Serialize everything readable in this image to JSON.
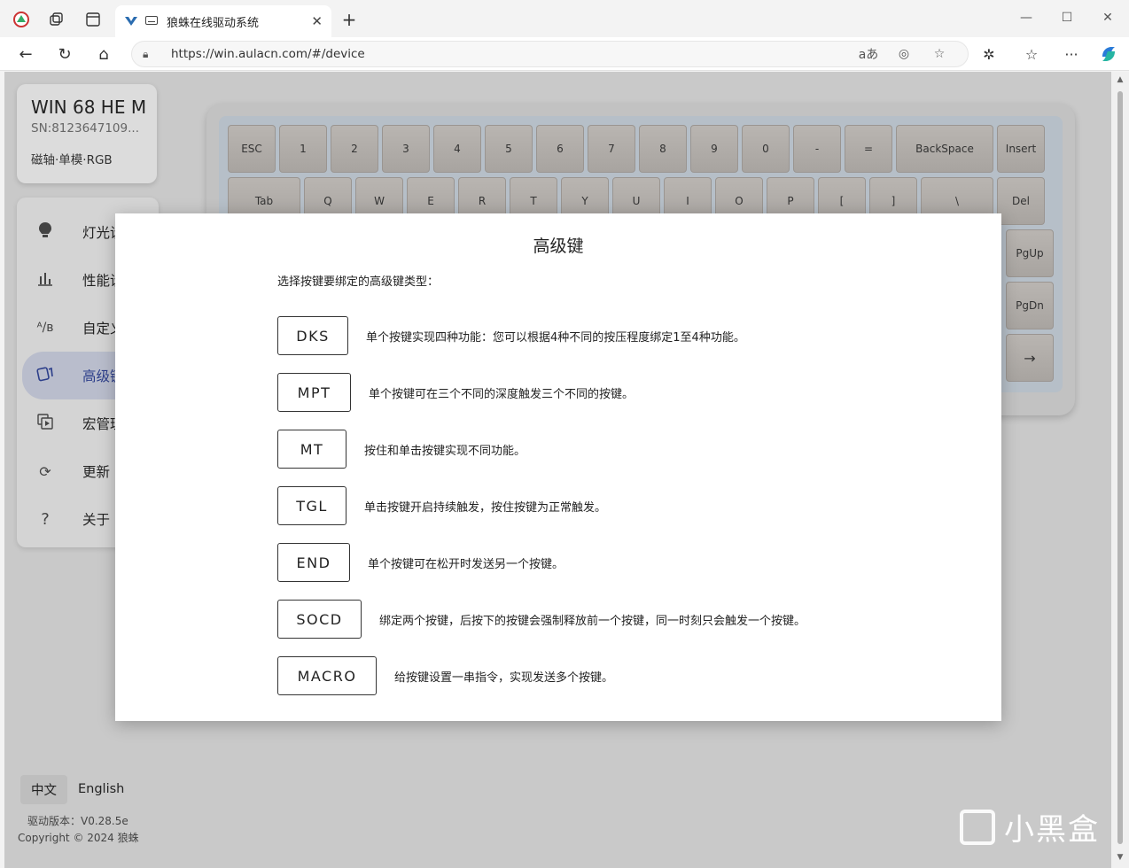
{
  "browser": {
    "tab_title": "狼蛛在线驱动系统",
    "url": "https://win.aulacn.com/#/device"
  },
  "device": {
    "name": "WIN 68 HE M",
    "sn": "SN:8123647109...",
    "spec": "磁轴·单模·RGB"
  },
  "sidebar": {
    "items": [
      {
        "label": "灯光设",
        "icon": "lightbulb-icon"
      },
      {
        "label": "性能设",
        "icon": "bar-chart-icon"
      },
      {
        "label": "自定义",
        "icon": "remap-icon"
      },
      {
        "label": "高级键",
        "icon": "advanced-key-icon"
      },
      {
        "label": "宏管理",
        "icon": "macro-icon"
      },
      {
        "label": "更新",
        "icon": "refresh-icon"
      },
      {
        "label": "关于",
        "icon": "question-icon"
      }
    ]
  },
  "keyboard": {
    "row1": [
      "ESC",
      "1",
      "2",
      "3",
      "4",
      "5",
      "6",
      "7",
      "8",
      "9",
      "0",
      "-",
      "=",
      "BackSpace",
      "Insert"
    ],
    "row2": [
      "Tab",
      "Q",
      "W",
      "E",
      "R",
      "T",
      "Y",
      "U",
      "I",
      "O",
      "P",
      "[",
      "]",
      "\\",
      "Del"
    ],
    "side_keys": [
      "PgUp",
      "PgDn",
      "→"
    ]
  },
  "footer": {
    "lang_zh": "中文",
    "lang_en": "English",
    "version": "驱动版本：V0.28.5e",
    "copyright": "Copyright © 2024 狼蛛"
  },
  "watermark": "小黑盒",
  "modal": {
    "title": "高级键",
    "prompt": "选择按键要绑定的高级键类型：",
    "options": [
      {
        "label": "DKS",
        "desc": "单个按键实现四种功能：您可以根据4种不同的按压程度绑定1至4种功能。"
      },
      {
        "label": "MPT",
        "desc": "单个按键可在三个不同的深度触发三个不同的按键。"
      },
      {
        "label": "MT",
        "desc": "按住和单击按键实现不同功能。"
      },
      {
        "label": "TGL",
        "desc": "单击按键开启持续触发，按住按键为正常触发。"
      },
      {
        "label": "END",
        "desc": "单个按键可在松开时发送另一个按键。"
      },
      {
        "label": "SOCD",
        "desc": "绑定两个按键，后按下的按键会强制释放前一个按键，同一时刻只会触发一个按键。"
      },
      {
        "label": "MACRO",
        "desc": "给按键设置一串指令，实现发送多个按键。"
      }
    ]
  }
}
